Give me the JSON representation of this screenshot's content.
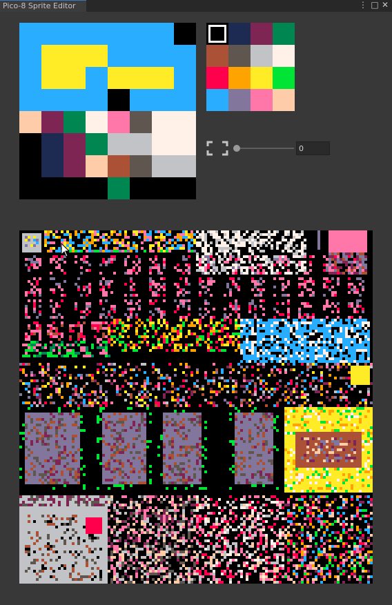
{
  "window": {
    "title": "Pico-8 Sprite Editor",
    "controls": {
      "menu": "⋮",
      "maximize": "□",
      "close": "✕"
    }
  },
  "palette": {
    "colors": [
      "#000000",
      "#1d2b53",
      "#7e2553",
      "#008751",
      "#ab5236",
      "#5f574f",
      "#c2c3c7",
      "#fff1e8",
      "#ff004d",
      "#ffa300",
      "#ffec27",
      "#00e436",
      "#29adff",
      "#83769c",
      "#ff77a8",
      "#ffccaa"
    ],
    "selected_index": 0
  },
  "sprite": {
    "pixels": [
      "CCCCCCCC",
      "CAAACCCC",
      "CAACAAAC",
      "CCCC0CCC",
      "F237E56F",
      "01236677",
      "012F456F",
      "00003000"
    ],
    "overrides": [
      {
        "row": 0,
        "col": 7,
        "color": 0
      },
      {
        "row": 3,
        "col": 4,
        "color": 0
      }
    ],
    "note_right_edge": "7 ff"
  },
  "zoom": {
    "value": "0",
    "level": 0.0,
    "icon": "fullscreen-icon"
  },
  "colors": {
    "background": "#383838",
    "tabbar": "#282828",
    "tab_active": "#3c3c3c",
    "accent": "#3a79bb"
  }
}
